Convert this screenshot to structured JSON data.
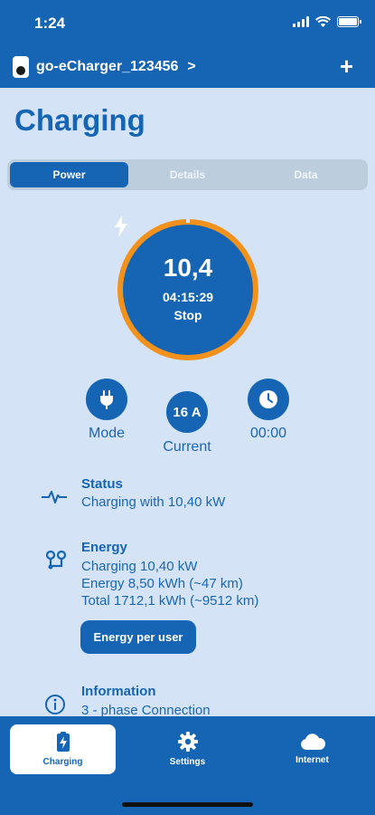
{
  "status_bar": {
    "time": "1:24"
  },
  "header": {
    "device_name": "go-eCharger_123456",
    "chevron": ">",
    "add": "+"
  },
  "page_title": "Charging",
  "tabs": [
    {
      "label": "Power",
      "active": true
    },
    {
      "label": "Details",
      "active": false
    },
    {
      "label": "Data",
      "active": false
    }
  ],
  "gauge": {
    "power": "10,4",
    "elapsed": "04:15:29",
    "action": "Stop",
    "ring_color": "#f2911b"
  },
  "controls": {
    "mode": {
      "label": "Mode",
      "icon": "plug-icon"
    },
    "current": {
      "value": "16 A",
      "label": "Current"
    },
    "timer": {
      "value": "00:00",
      "icon": "clock-icon"
    }
  },
  "status": {
    "title": "Status",
    "line": "Charging with 10,40 kW",
    "icon": "pulse-icon"
  },
  "energy": {
    "title": "Energy",
    "lines": [
      "Charging 10,40 kW",
      "Energy 8,50 kWh (~47 km)",
      "Total 1712,1 kWh (~9512 km)"
    ],
    "button": "Energy per user",
    "icon": "energy-nodes-icon"
  },
  "information": {
    "title": "Information",
    "line": "3 - phase Connection",
    "icon": "info-icon"
  },
  "nav": [
    {
      "label": "Charging",
      "icon": "battery-charging-icon",
      "active": true
    },
    {
      "label": "Settings",
      "icon": "gear-icon",
      "active": false
    },
    {
      "label": "Internet",
      "icon": "cloud-icon",
      "active": false
    }
  ],
  "colors": {
    "primary": "#1565b4",
    "background": "#d4e4f6",
    "accent": "#f2911b"
  }
}
